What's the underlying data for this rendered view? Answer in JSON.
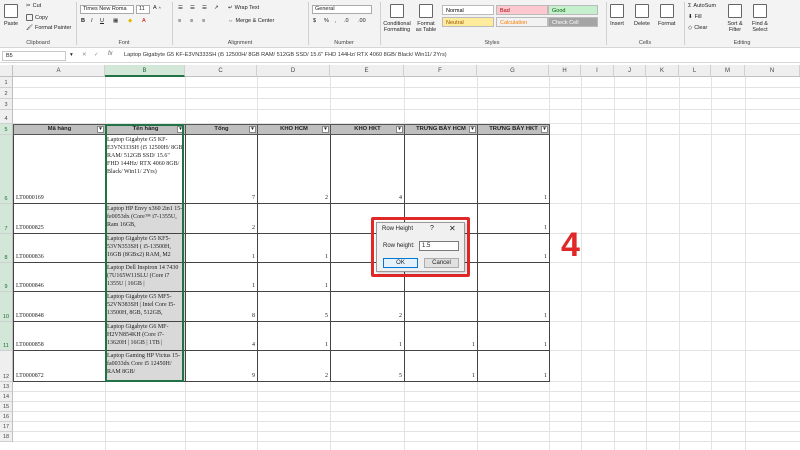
{
  "ribbon": {
    "clipboard": {
      "paste": "Paste",
      "cut": "Cut",
      "copy": "Copy",
      "format_painter": "Format Painter",
      "label": "Clipboard"
    },
    "font": {
      "name": "Times New Roma",
      "size": "11",
      "label": "Font"
    },
    "alignment": {
      "wrap_text": "Wrap Text",
      "merge_center": "Merge & Center",
      "label": "Alignment"
    },
    "number": {
      "format": "General",
      "label": "Number"
    },
    "styles": {
      "conditional": "Conditional Formatting",
      "format_as_table": "Format as Table",
      "cells": [
        {
          "label": "Normal",
          "bg": "#ffffff",
          "fg": "#000000"
        },
        {
          "label": "Bad",
          "bg": "#ffc7ce",
          "fg": "#9c0006"
        },
        {
          "label": "Good",
          "bg": "#c6efce",
          "fg": "#006100"
        },
        {
          "label": "Neutral",
          "bg": "#ffeb9c",
          "fg": "#9c5700"
        },
        {
          "label": "Calculation",
          "bg": "#f2f2f2",
          "fg": "#fa7d00"
        },
        {
          "label": "Check Cell",
          "bg": "#a5a5a5",
          "fg": "#ffffff"
        }
      ],
      "label": "Styles"
    },
    "cells": {
      "insert": "Insert",
      "delete": "Delete",
      "format": "Format",
      "label": "Cells"
    },
    "editing": {
      "autosum": "AutoSum",
      "fill": "Fill",
      "clear": "Clear",
      "sort": "Sort & Filter",
      "find": "Find & Select",
      "label": "Editing"
    }
  },
  "formula_bar": {
    "name_box": "B5",
    "fx": "fx",
    "content": "Laptop Gigabyte G5 KF-E3VN333SH (i5 12500H/ 8GB RAM/ 512GB SSD/ 15.6\" FHD 144Hz/ RTX 4060 8GB/ Black/ Win11/ 2Yrs)"
  },
  "columns": [
    "A",
    "B",
    "C",
    "D",
    "E",
    "F",
    "G",
    "H",
    "I",
    "J",
    "K",
    "L",
    "M",
    "N"
  ],
  "rows": [
    "1",
    "2",
    "3",
    "4",
    "5",
    "6",
    "7",
    "8",
    "9",
    "10",
    "11",
    "12",
    "13",
    "14",
    "15",
    "16",
    "17",
    "18"
  ],
  "table": {
    "headers": [
      "Mã hàng",
      "Tên hàng",
      "Tổng",
      "KHO HCM",
      "KHO HKT",
      "TRƯNG BÀY HCM",
      "TRƯNG BÀY HKT"
    ],
    "rows": [
      {
        "code": "LT0000169",
        "name": "Laptop Gigabyte G5 KF-E3VN333SH (i5 12500H/ 8GB RAM/ 512GB SSD/ 15.6\" FHD 144Hz/ RTX 4060 8GB/ Black/ Win11/ 2Yrs)",
        "total": "7",
        "hcm": "2",
        "hkt": "4",
        "tb_hcm": "",
        "tb_hkt": "1"
      },
      {
        "code": "LT0000825",
        "name": "Laptop HP Envy x360 2in1 15-fe0053dx (Core™ i7-1355U, Ram 16GB,",
        "total": "2",
        "hcm": "",
        "hkt": "",
        "tb_hcm": "",
        "tb_hkt": "1"
      },
      {
        "code": "LT0000836",
        "name": "Laptop Gigabyte G5 KF5-53VN353SH ( i5-13500H, 16GB (8GBx2) RAM, M2",
        "total": "1",
        "hcm": "1",
        "hkt": "",
        "tb_hcm": "",
        "tb_hkt": "1"
      },
      {
        "code": "LT0000846",
        "name": "Laptop Dell Inspiron 14 7430 (7U165W11SLU (Core i7 1355U | 16GB |",
        "total": "1",
        "hcm": "1",
        "hkt": "",
        "tb_hcm": "",
        "tb_hkt": ""
      },
      {
        "code": "LT0000848",
        "name": "Laptop Gigabyte G5 MF5-52VN383SH | Intel Core I5-13500H, 8GB, 512GB,",
        "total": "8",
        "hcm": "5",
        "hkt": "2",
        "tb_hcm": "",
        "tb_hkt": "1"
      },
      {
        "code": "LT0000858",
        "name": "Laptop Gigabyte G6 MF-H2VN854KH (Core i7-13620H | 16GB | 1TB |",
        "total": "4",
        "hcm": "1",
        "hkt": "1",
        "tb_hcm": "1",
        "tb_hkt": "1"
      },
      {
        "code": "LT0000872",
        "name": "Laptop Gaming HP Victus 15-fa0033dx Core i5 12450H/ RAM 8GB/",
        "total": "9",
        "hcm": "2",
        "hkt": "5",
        "tb_hcm": "1",
        "tb_hkt": "1"
      }
    ]
  },
  "dialog": {
    "title": "Row Height",
    "help": "?",
    "close": "✕",
    "label": "Row height:",
    "value": "1.5",
    "ok": "OK",
    "cancel": "Cancel"
  },
  "step_number": "4",
  "colors": {
    "accent": "#217346",
    "highlight": "#e02828"
  }
}
